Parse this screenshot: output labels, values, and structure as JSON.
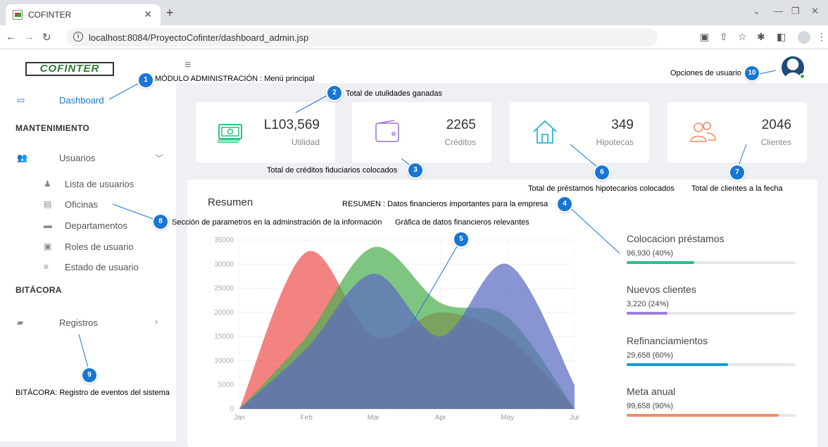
{
  "browser": {
    "tab_title": "COFINTER",
    "url": "localhost:8084/ProyectoCofinter/dashboard_admin.jsp"
  },
  "app": {
    "logo_text": "COFINTER"
  },
  "sidebar": {
    "dashboard_label": "Dashboard",
    "section_mantenimiento": "MANTENIMIENTO",
    "usuarios_label": "Usuarios",
    "subitems": [
      {
        "label": "Lista de usuarios",
        "icon": "user-icon"
      },
      {
        "label": "Oficinas",
        "icon": "office-icon"
      },
      {
        "label": "Departamentos",
        "icon": "folder-icon"
      },
      {
        "label": "Roles de usuario",
        "icon": "id-card-icon"
      },
      {
        "label": "Estado de usuario",
        "icon": "list-icon"
      }
    ],
    "section_bitacora": "BITÁCORA",
    "registros_label": "Registros"
  },
  "cards": [
    {
      "value": "L103,569",
      "label": "Utilidad",
      "icon": "money-icon",
      "color": "#2dbf7e"
    },
    {
      "value": "2265",
      "label": "Créditos",
      "icon": "wallet-icon",
      "color": "#9b6fd6"
    },
    {
      "value": "349",
      "label": "Hipotecas",
      "icon": "house-icon",
      "color": "#2bb5d6"
    },
    {
      "value": "2046",
      "label": "Clientes",
      "icon": "users-icon",
      "color": "#f08a5d"
    }
  ],
  "panel": {
    "title": "Resumen"
  },
  "stats": [
    {
      "title": "Colocacion préstamos",
      "value": "96,930 (40%)",
      "percent": 40,
      "color": "#2bbf8a"
    },
    {
      "title": "Nuevos clientes",
      "value": "3,220 (24%)",
      "percent": 24,
      "color": "#9b7fd4"
    },
    {
      "title": "Refinanciamientos",
      "value": "29,658 (60%)",
      "percent": 60,
      "color": "#1a9ad6"
    },
    {
      "title": "Meta anual",
      "value": "99,658 (90%)",
      "percent": 90,
      "color": "#f08a6a"
    }
  ],
  "annotations": [
    {
      "num": "1",
      "text": "MÓDULO ADMINISTRACIÓN : Menú principal"
    },
    {
      "num": "2",
      "text": "Total de utulidades ganadas"
    },
    {
      "num": "3",
      "text": "Total de créditos fiduciarios colocados"
    },
    {
      "num": "4",
      "text": "RESUMEN : Datos financieros importantes para la empresa"
    },
    {
      "num": "5",
      "text": "Gráfica de datos financieros relevantes"
    },
    {
      "num": "6",
      "text": "Total de préstamos hipotecarios colocados"
    },
    {
      "num": "7",
      "text": "Total de clientes a la fecha"
    },
    {
      "num": "8",
      "text": "Sección de parametros en la adminstración de la información"
    },
    {
      "num": "9",
      "text": "BITÁCORA: Registro de eventos del sistema"
    },
    {
      "num": "10",
      "text": "Opciones de usuario"
    }
  ],
  "chart_data": {
    "type": "area",
    "categories": [
      "Jan",
      "Feb",
      "Mar",
      "Apr",
      "May",
      "Jur"
    ],
    "ylim": [
      0,
      35000
    ],
    "yticks": [
      "0",
      "5000",
      "10000",
      "15000",
      "20000",
      "25000",
      "30000",
      "35000"
    ],
    "series": [
      {
        "color": "#ef5350",
        "values": [
          0,
          32500,
          15000,
          20000,
          15000,
          0
        ]
      },
      {
        "color": "#4caf50",
        "values": [
          0,
          15000,
          33500,
          22000,
          19000,
          0
        ]
      },
      {
        "color": "#5c6bc0",
        "values": [
          0,
          12500,
          28000,
          15000,
          30000,
          5000
        ]
      }
    ]
  }
}
